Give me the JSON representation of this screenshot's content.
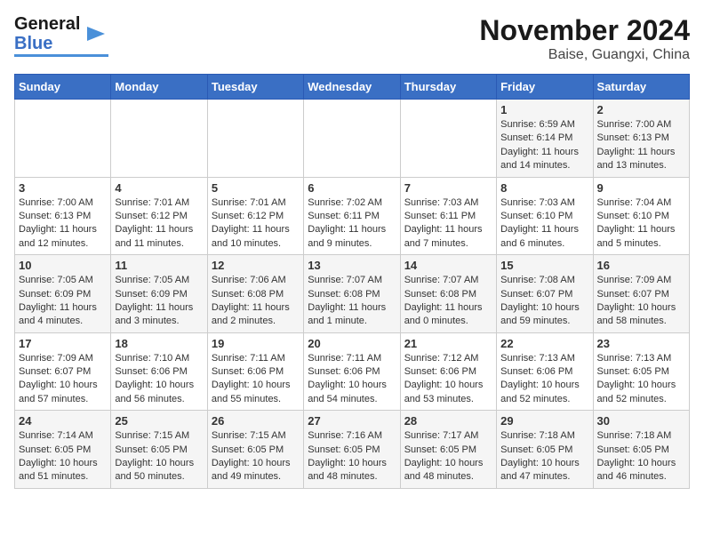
{
  "header": {
    "logo_line1": "General",
    "logo_line2": "Blue",
    "title": "November 2024",
    "subtitle": "Baise, Guangxi, China"
  },
  "columns": [
    "Sunday",
    "Monday",
    "Tuesday",
    "Wednesday",
    "Thursday",
    "Friday",
    "Saturday"
  ],
  "weeks": [
    [
      {
        "day": "",
        "info": ""
      },
      {
        "day": "",
        "info": ""
      },
      {
        "day": "",
        "info": ""
      },
      {
        "day": "",
        "info": ""
      },
      {
        "day": "",
        "info": ""
      },
      {
        "day": "1",
        "info": "Sunrise: 6:59 AM\nSunset: 6:14 PM\nDaylight: 11 hours and 14 minutes."
      },
      {
        "day": "2",
        "info": "Sunrise: 7:00 AM\nSunset: 6:13 PM\nDaylight: 11 hours and 13 minutes."
      }
    ],
    [
      {
        "day": "3",
        "info": "Sunrise: 7:00 AM\nSunset: 6:13 PM\nDaylight: 11 hours and 12 minutes."
      },
      {
        "day": "4",
        "info": "Sunrise: 7:01 AM\nSunset: 6:12 PM\nDaylight: 11 hours and 11 minutes."
      },
      {
        "day": "5",
        "info": "Sunrise: 7:01 AM\nSunset: 6:12 PM\nDaylight: 11 hours and 10 minutes."
      },
      {
        "day": "6",
        "info": "Sunrise: 7:02 AM\nSunset: 6:11 PM\nDaylight: 11 hours and 9 minutes."
      },
      {
        "day": "7",
        "info": "Sunrise: 7:03 AM\nSunset: 6:11 PM\nDaylight: 11 hours and 7 minutes."
      },
      {
        "day": "8",
        "info": "Sunrise: 7:03 AM\nSunset: 6:10 PM\nDaylight: 11 hours and 6 minutes."
      },
      {
        "day": "9",
        "info": "Sunrise: 7:04 AM\nSunset: 6:10 PM\nDaylight: 11 hours and 5 minutes."
      }
    ],
    [
      {
        "day": "10",
        "info": "Sunrise: 7:05 AM\nSunset: 6:09 PM\nDaylight: 11 hours and 4 minutes."
      },
      {
        "day": "11",
        "info": "Sunrise: 7:05 AM\nSunset: 6:09 PM\nDaylight: 11 hours and 3 minutes."
      },
      {
        "day": "12",
        "info": "Sunrise: 7:06 AM\nSunset: 6:08 PM\nDaylight: 11 hours and 2 minutes."
      },
      {
        "day": "13",
        "info": "Sunrise: 7:07 AM\nSunset: 6:08 PM\nDaylight: 11 hours and 1 minute."
      },
      {
        "day": "14",
        "info": "Sunrise: 7:07 AM\nSunset: 6:08 PM\nDaylight: 11 hours and 0 minutes."
      },
      {
        "day": "15",
        "info": "Sunrise: 7:08 AM\nSunset: 6:07 PM\nDaylight: 10 hours and 59 minutes."
      },
      {
        "day": "16",
        "info": "Sunrise: 7:09 AM\nSunset: 6:07 PM\nDaylight: 10 hours and 58 minutes."
      }
    ],
    [
      {
        "day": "17",
        "info": "Sunrise: 7:09 AM\nSunset: 6:07 PM\nDaylight: 10 hours and 57 minutes."
      },
      {
        "day": "18",
        "info": "Sunrise: 7:10 AM\nSunset: 6:06 PM\nDaylight: 10 hours and 56 minutes."
      },
      {
        "day": "19",
        "info": "Sunrise: 7:11 AM\nSunset: 6:06 PM\nDaylight: 10 hours and 55 minutes."
      },
      {
        "day": "20",
        "info": "Sunrise: 7:11 AM\nSunset: 6:06 PM\nDaylight: 10 hours and 54 minutes."
      },
      {
        "day": "21",
        "info": "Sunrise: 7:12 AM\nSunset: 6:06 PM\nDaylight: 10 hours and 53 minutes."
      },
      {
        "day": "22",
        "info": "Sunrise: 7:13 AM\nSunset: 6:06 PM\nDaylight: 10 hours and 52 minutes."
      },
      {
        "day": "23",
        "info": "Sunrise: 7:13 AM\nSunset: 6:05 PM\nDaylight: 10 hours and 52 minutes."
      }
    ],
    [
      {
        "day": "24",
        "info": "Sunrise: 7:14 AM\nSunset: 6:05 PM\nDaylight: 10 hours and 51 minutes."
      },
      {
        "day": "25",
        "info": "Sunrise: 7:15 AM\nSunset: 6:05 PM\nDaylight: 10 hours and 50 minutes."
      },
      {
        "day": "26",
        "info": "Sunrise: 7:15 AM\nSunset: 6:05 PM\nDaylight: 10 hours and 49 minutes."
      },
      {
        "day": "27",
        "info": "Sunrise: 7:16 AM\nSunset: 6:05 PM\nDaylight: 10 hours and 48 minutes."
      },
      {
        "day": "28",
        "info": "Sunrise: 7:17 AM\nSunset: 6:05 PM\nDaylight: 10 hours and 48 minutes."
      },
      {
        "day": "29",
        "info": "Sunrise: 7:18 AM\nSunset: 6:05 PM\nDaylight: 10 hours and 47 minutes."
      },
      {
        "day": "30",
        "info": "Sunrise: 7:18 AM\nSunset: 6:05 PM\nDaylight: 10 hours and 46 minutes."
      }
    ]
  ]
}
